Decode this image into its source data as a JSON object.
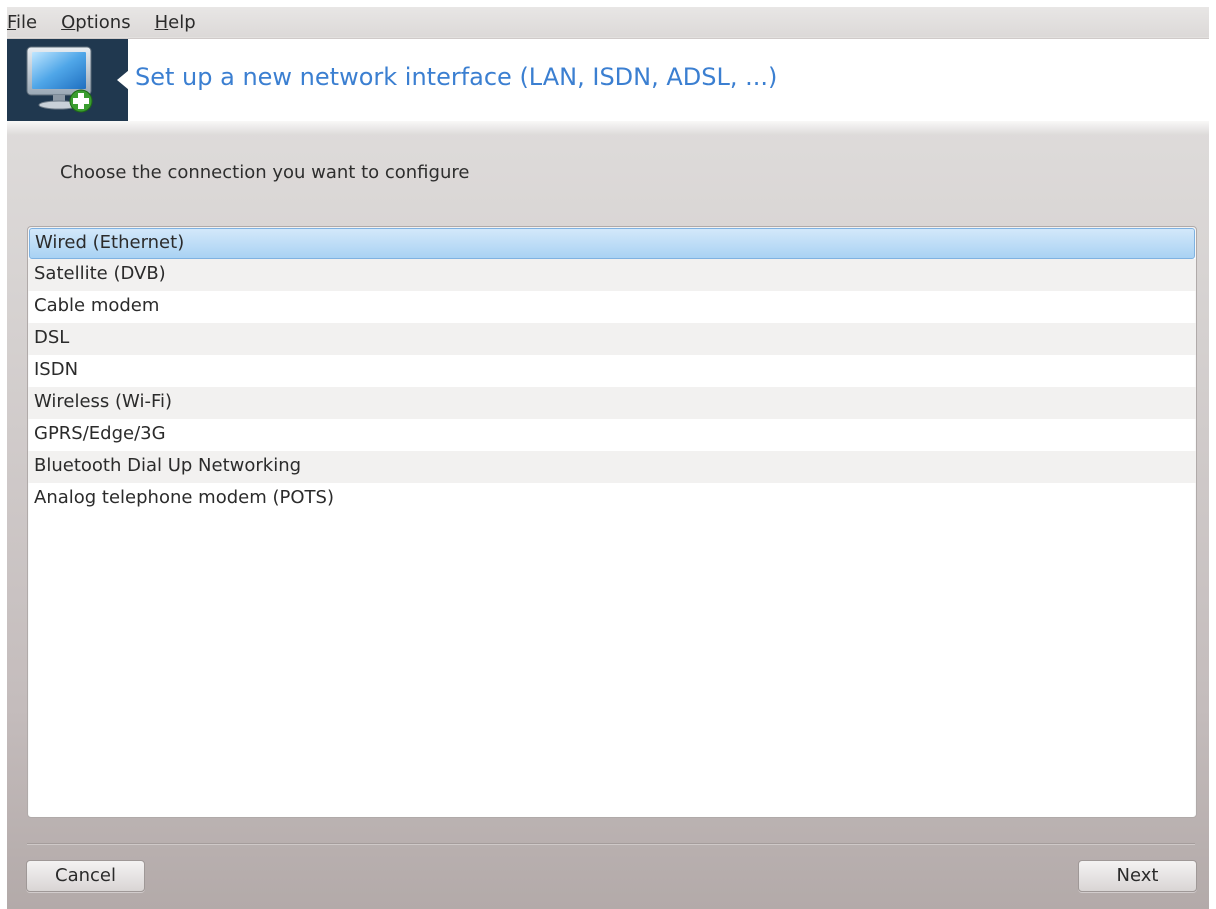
{
  "menubar": {
    "items": [
      {
        "mnemonic": "F",
        "rest": "ile"
      },
      {
        "mnemonic": "O",
        "rest": "ptions"
      },
      {
        "mnemonic": "H",
        "rest": "elp"
      }
    ]
  },
  "banner": {
    "title": "Set up a new network interface (LAN, ISDN, ADSL, ...)",
    "icon": "monitor-add-icon"
  },
  "prompt": "Choose the connection you want to configure",
  "connections": {
    "selected_index": 0,
    "items": [
      "Wired (Ethernet)",
      "Satellite (DVB)",
      "Cable modem",
      "DSL",
      "ISDN",
      "Wireless (Wi-Fi)",
      "GPRS/Edge/3G",
      "Bluetooth Dial Up Networking",
      "Analog telephone modem (POTS)"
    ]
  },
  "buttons": {
    "cancel": "Cancel",
    "next": "Next"
  },
  "colors": {
    "title": "#3b7fd1",
    "banner_icon_bg": "#20384f",
    "selection": "#a9d2f3"
  }
}
